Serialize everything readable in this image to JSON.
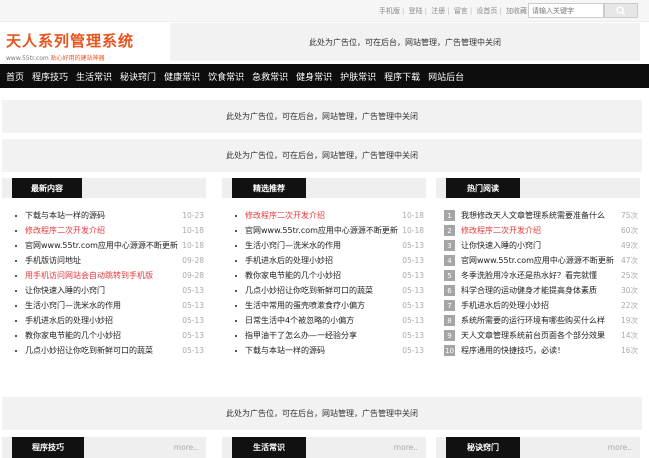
{
  "topbar": {
    "links": [
      "手机版",
      "登陆",
      "注册",
      "留言",
      "设首页",
      "加收藏"
    ],
    "search_placeholder": "请输入关键字"
  },
  "logo": {
    "title": "天人系列管理系统",
    "url": "www.55tr.com",
    "slogan": "贴心好用的建站神器"
  },
  "ad_text": "此处为广告位，可在后台，网站管理，广告管理中关闭",
  "nav": [
    "首页",
    "程序技巧",
    "生活常识",
    "秘诀窍门",
    "健康常识",
    "饮食常识",
    "急救常识",
    "健身常识",
    "护肤常识",
    "程序下载",
    "网站后台"
  ],
  "panels": [
    {
      "title": "最新内容",
      "items": [
        {
          "title": "下载与本站一样的源码",
          "date": "10-23",
          "red": false
        },
        {
          "title": "修改程序二次开发介绍",
          "date": "10-18",
          "red": true
        },
        {
          "title": "官网www.55tr.com应用中心源源不断更新",
          "date": "10-18",
          "red": false
        },
        {
          "title": "手机版访问地址",
          "date": "09-28",
          "red": false
        },
        {
          "title": "用手机访问网站会自动跳转到手机版",
          "date": "09-28",
          "red": true
        },
        {
          "title": "让你快速入睡的小窍门",
          "date": "05-13",
          "red": false
        },
        {
          "title": "生活小窍门—洗米水的作用",
          "date": "05-13",
          "red": false
        },
        {
          "title": "手机进水后的处理小妙招",
          "date": "05-13",
          "red": false
        },
        {
          "title": "教你家电节能的几个小妙招",
          "date": "05-13",
          "red": false
        },
        {
          "title": "几点小妙招让你吃到新鲜可口的蔬菜",
          "date": "05-13",
          "red": false
        }
      ]
    },
    {
      "title": "精选推荐",
      "items": [
        {
          "title": "修改程序二次开发介绍",
          "date": "10-18",
          "red": true
        },
        {
          "title": "官网www.55tr.com应用中心源源不断更新",
          "date": "10-18",
          "red": false
        },
        {
          "title": "生活小窍门—洗米水的作用",
          "date": "05-13",
          "red": false
        },
        {
          "title": "手机进水后的处理小妙招",
          "date": "05-13",
          "red": false
        },
        {
          "title": "教你家电节能的几个小妙招",
          "date": "05-13",
          "red": false
        },
        {
          "title": "几点小妙招让你吃到新鲜可口的蔬菜",
          "date": "05-13",
          "red": false
        },
        {
          "title": "生活中常用的蛋壳喷漱食疗小偏方",
          "date": "05-13",
          "red": false
        },
        {
          "title": "日常生活中4个被忽略的小偏方",
          "date": "05-13",
          "red": false
        },
        {
          "title": "指甲油干了怎么办—一经验分享",
          "date": "05-13",
          "red": false
        },
        {
          "title": "下载与本站一样的源码",
          "date": "05-13",
          "red": false
        }
      ]
    },
    {
      "title": "热门阅读",
      "items": [
        {
          "num": "1",
          "title": "我想修改天人文章管理系统需要准备什么",
          "date": "75次",
          "red": false
        },
        {
          "num": "2",
          "title": "修改程序二次开发介绍",
          "date": "60次",
          "red": true
        },
        {
          "num": "3",
          "title": "让你快速入睡的小窍门",
          "date": "49次",
          "red": false
        },
        {
          "num": "4",
          "title": "官网www.55tr.com应用中心源源不断更新",
          "date": "47次",
          "red": false
        },
        {
          "num": "5",
          "title": "冬季洗脸用冷水还是热水好？看完就懂",
          "date": "25次",
          "red": false
        },
        {
          "num": "6",
          "title": "科学合理的运动健身才能提高身体素质",
          "date": "30次",
          "red": false
        },
        {
          "num": "7",
          "title": "手机进水后的处理小妙招",
          "date": "22次",
          "red": false
        },
        {
          "num": "8",
          "title": "系统所需要的运行环境有哪些购买什么样",
          "date": "19次",
          "red": false
        },
        {
          "num": "9",
          "title": "天人文章管理系统前台页面各个部分效果",
          "date": "14次",
          "red": false
        },
        {
          "num": "10",
          "title": "程序通用的快捷技巧，必读！",
          "date": "16次",
          "red": false
        }
      ]
    }
  ],
  "bottom_panels": [
    {
      "title": "程序技巧",
      "more": "more.."
    },
    {
      "title": "生活常识",
      "more": "more.."
    },
    {
      "title": "秘诀窍门",
      "more": "more.."
    }
  ]
}
